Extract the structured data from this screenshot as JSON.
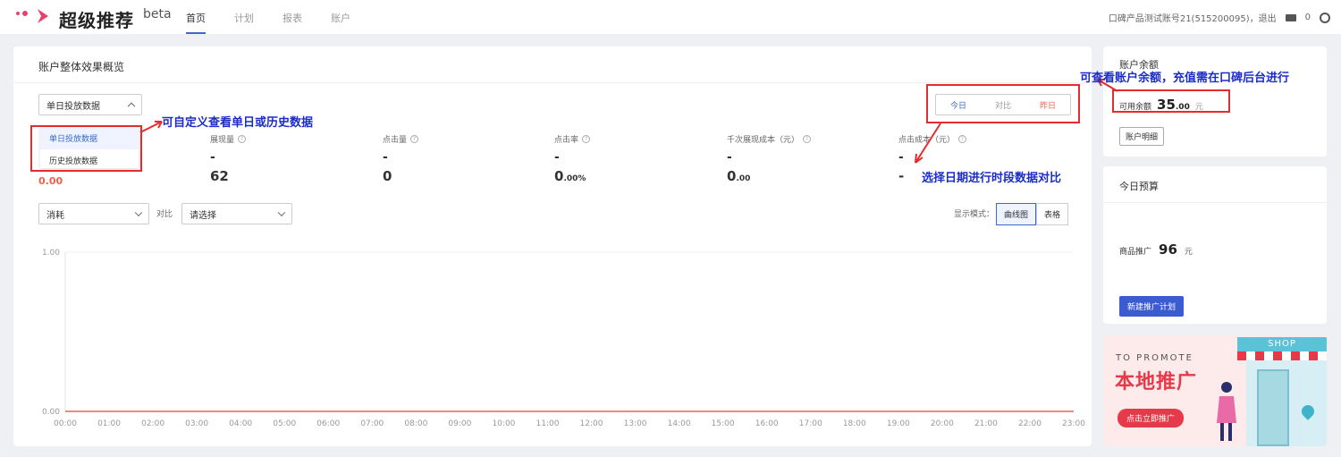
{
  "app": {
    "brand": "超级推荐",
    "beta": "beta",
    "accent": "#3b6ac9"
  },
  "nav": {
    "items": [
      "首页",
      "计划",
      "报表",
      "账户"
    ],
    "active": 0
  },
  "user": {
    "account_text": "口碑产品测试账号21(515200095)，退出",
    "mail_count": "0"
  },
  "overview": {
    "title": "账户整体效果概览",
    "data_select": {
      "value": "单日投放数据",
      "options": [
        "单日投放数据",
        "历史投放数据"
      ]
    },
    "date_tabs": {
      "today": "今日",
      "compare": "对比",
      "yesterday": "昨日"
    },
    "metrics": [
      {
        "label": "展现量",
        "dash": "-",
        "value": "62",
        "unit": ""
      },
      {
        "label": "点击量",
        "dash": "-",
        "value": "0",
        "unit": ""
      },
      {
        "label": "点击率",
        "dash": "-",
        "value": "0",
        "unit": ".00%"
      },
      {
        "label": "千次展现成本（元）",
        "dash": "-",
        "value": "0",
        "unit": ".00"
      },
      {
        "label": "点击成本（元）",
        "dash": "-",
        "value": "-",
        "unit": ""
      }
    ],
    "partial_metric": "0.00",
    "metric_select": {
      "value": "消耗"
    },
    "compare_label": "对比",
    "compare_select": {
      "placeholder": "请选择"
    },
    "display_mode_label": "显示模式：",
    "mode_buttons": [
      "曲线图",
      "表格"
    ]
  },
  "chart_data": {
    "type": "line",
    "ylim": [
      0,
      1
    ],
    "y_ticks": [
      "1.00",
      "0.00"
    ],
    "categories": [
      "00:00",
      "01:00",
      "02:00",
      "03:00",
      "04:00",
      "05:00",
      "06:00",
      "07:00",
      "08:00",
      "09:00",
      "10:00",
      "11:00",
      "12:00",
      "13:00",
      "14:00",
      "15:00",
      "16:00",
      "17:00",
      "18:00",
      "19:00",
      "20:00",
      "21:00",
      "22:00",
      "23:00"
    ],
    "series": [
      {
        "values": [
          0,
          0,
          0,
          0,
          0,
          0,
          0,
          0,
          0,
          0,
          0,
          0,
          0,
          0,
          0,
          0,
          0,
          0,
          0,
          0,
          0,
          0,
          0,
          0
        ],
        "color": "#e8634b"
      }
    ]
  },
  "balance": {
    "title": "账户余额",
    "label": "可用余额",
    "value_int": "35",
    "value_dec": ".00",
    "unit": "元",
    "detail_btn": "账户明细"
  },
  "budget": {
    "title": "今日预算",
    "label": "商品推广",
    "value": "96",
    "unit": "元",
    "new_plan_btn": "新建推广计划"
  },
  "promo": {
    "en": "TO PROMOTE",
    "cn": "本地推广",
    "btn": "点击立即推广",
    "shop": "SHOP"
  },
  "annotations": {
    "custom_view": "可自定义查看单日或历史数据",
    "date_compare": "选择日期进行时段数据对比",
    "balance_note": "可查看账户余额，充值需在口碑后台进行"
  }
}
